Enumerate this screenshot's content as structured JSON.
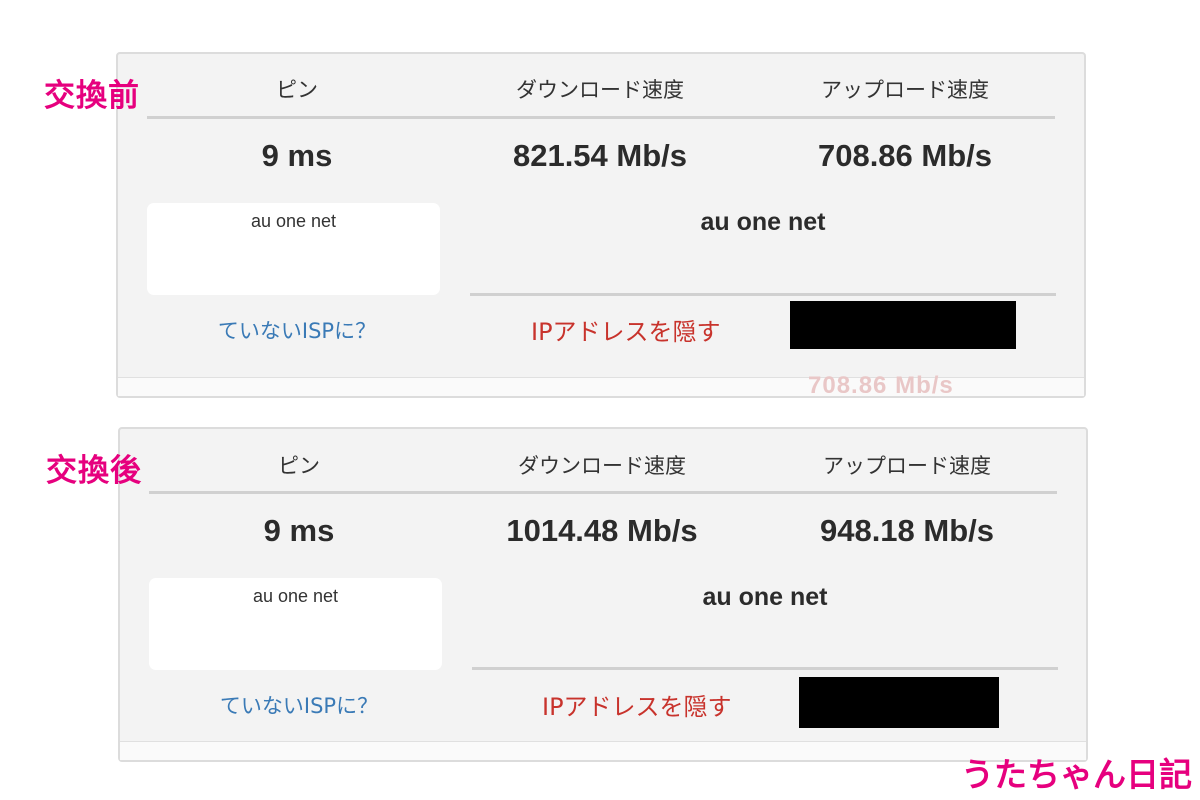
{
  "before": {
    "label": "交換前",
    "headers": {
      "ping": "ピン",
      "download": "ダウンロード速度",
      "upload": "アップロード速度"
    },
    "values": {
      "ping": "9 ms",
      "download": "821.54 Mb/s",
      "upload": "708.86 Mb/s"
    },
    "isp_box_text": "au one net",
    "isp_name": "au one net",
    "isp_link": "ていないISPに？",
    "hide_ip": "IPアドレスを隠す",
    "faded_text": "708.86 Mb/s"
  },
  "after": {
    "label": "交換後",
    "headers": {
      "ping": "ピン",
      "download": "ダウンロード速度",
      "upload": "アップロード速度"
    },
    "values": {
      "ping": "9 ms",
      "download": "1014.48 Mb/s",
      "upload": "948.18 Mb/s"
    },
    "isp_box_text": "au one net",
    "isp_name": "au one net",
    "isp_link": "ていないISPに？",
    "hide_ip": "IPアドレスを隠す"
  },
  "footer": "うたちゃん日記",
  "colors": {
    "label": "#e6007e",
    "link": "#3a7ab6",
    "hide_ip": "#c8332c"
  }
}
